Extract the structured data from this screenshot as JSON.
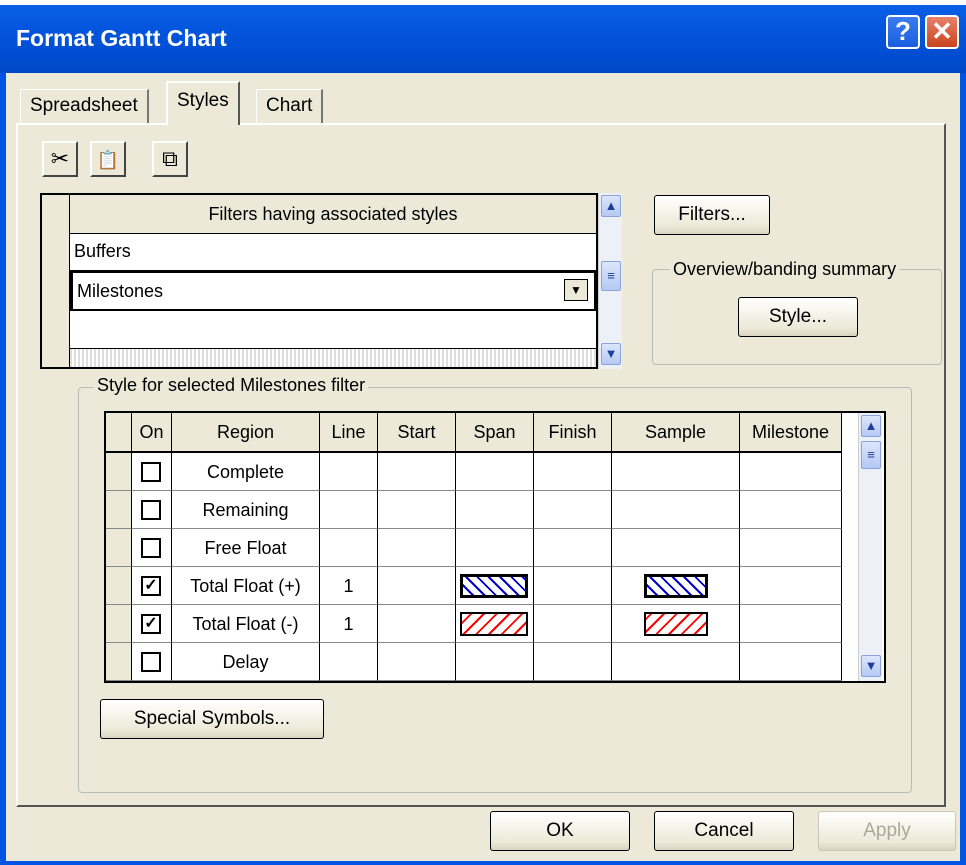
{
  "window": {
    "title": "Format Gantt Chart",
    "help_glyph": "?",
    "close_glyph": "✕"
  },
  "tabs": [
    {
      "label": "Spreadsheet",
      "active": false
    },
    {
      "label": "Styles",
      "active": true
    },
    {
      "label": "Chart",
      "active": false
    }
  ],
  "toolbar": {
    "cut_glyph": "✂",
    "paste_glyph": "📋",
    "copy_glyph": "⧉"
  },
  "filters_grid": {
    "header": "Filters having associated styles",
    "rows": [
      "Buffers",
      "Milestones",
      ""
    ],
    "selected_row": 1,
    "dropdown_glyph": "▼"
  },
  "buttons": {
    "filters": "Filters...",
    "style": "Style...",
    "special_symbols": "Special Symbols...",
    "ok": "OK",
    "cancel": "Cancel",
    "apply": "Apply"
  },
  "overview_group": {
    "label": "Overview/banding summary"
  },
  "style_group": {
    "label": "Style for selected Milestones filter"
  },
  "style_grid": {
    "columns": [
      "On",
      "Region",
      "Line",
      "Start",
      "Span",
      "Finish",
      "Sample",
      "Milestone"
    ],
    "rows": [
      {
        "on": false,
        "region": "Complete",
        "line": "",
        "span": "",
        "sample": ""
      },
      {
        "on": false,
        "region": "Remaining",
        "line": "",
        "span": "",
        "sample": ""
      },
      {
        "on": false,
        "region": "Free Float",
        "line": "",
        "span": "",
        "sample": ""
      },
      {
        "on": true,
        "region": "Total Float (+)",
        "line": "1",
        "span": "blue-hatch",
        "sample": "blue-hatch"
      },
      {
        "on": true,
        "region": "Total Float (-)",
        "line": "1",
        "span": "red-hatch",
        "sample": "red-hatch"
      },
      {
        "on": false,
        "region": "Delay",
        "line": "",
        "span": "",
        "sample": ""
      }
    ]
  },
  "scroll": {
    "up_glyph": "▲",
    "down_glyph": "▼",
    "thumb_glyph": "≡"
  },
  "colors": {
    "title_bar": "#0054e3",
    "dialog_bg": "#ece9d8",
    "hatch_blue": "#0000cc",
    "hatch_red": "#ff0000"
  }
}
